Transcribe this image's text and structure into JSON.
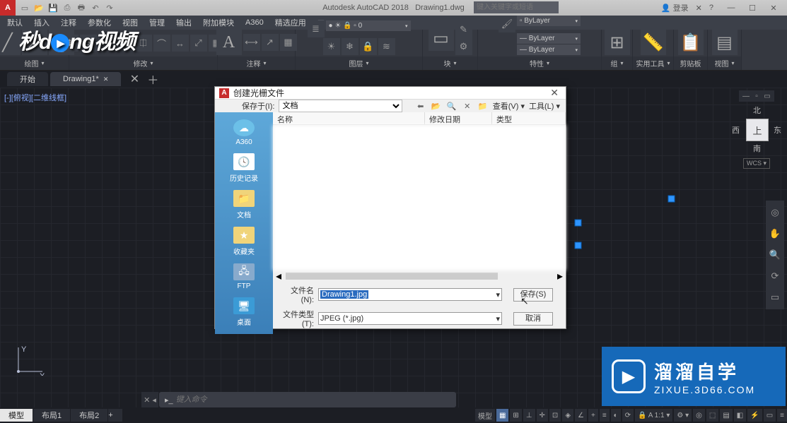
{
  "titlebar": {
    "app_name": "Autodesk AutoCAD 2018",
    "doc_name": "Drawing1.dwg",
    "search_placeholder": "键入关键字或短语",
    "login": "登录"
  },
  "menu": [
    "默认",
    "插入",
    "注释",
    "参数化",
    "视图",
    "管理",
    "输出",
    "附加模块",
    "A360",
    "精选应用"
  ],
  "ribbon": {
    "panels": [
      "绘图",
      "修改",
      "注释",
      "图层",
      "块",
      "特性",
      "组",
      "实用工具",
      "剪贴板",
      "视图"
    ],
    "prop_bylayer": "ByLayer"
  },
  "doctabs": {
    "start": "开始",
    "drawing": "Drawing1*"
  },
  "view_label": "[-][俯视][二维线框]",
  "viewcube": {
    "face": "上",
    "n": "北",
    "s": "南",
    "e": "东",
    "w": "西",
    "wcs": "WCS"
  },
  "dialog": {
    "title": "创建光栅文件",
    "savein_label": "保存于(I):",
    "savein_value": "文档",
    "toolbar": {
      "view": "查看(V)",
      "tools": "工具(L)"
    },
    "places": [
      {
        "label": "A360"
      },
      {
        "label": "历史记录"
      },
      {
        "label": "文档"
      },
      {
        "label": "收藏夹"
      },
      {
        "label": "FTP"
      },
      {
        "label": "桌面"
      }
    ],
    "cols": {
      "name": "名称",
      "date": "修改日期",
      "type": "类型"
    },
    "filename_label": "文件名(N):",
    "filename_value": "Drawing1.jpg",
    "filetype_label": "文件类型(T):",
    "filetype_value": "JPEG (*.jpg)",
    "save_btn": "保存(S)",
    "cancel_btn": "取消"
  },
  "cmd_placeholder": "键入命令",
  "modeltabs": {
    "model": "模型",
    "l1": "布局1",
    "l2": "布局2"
  },
  "status_model": "模型",
  "brand": {
    "l1": "溜溜自学",
    "l2": "ZIXUE.3D66.COM"
  },
  "logo": "秒dong视频"
}
